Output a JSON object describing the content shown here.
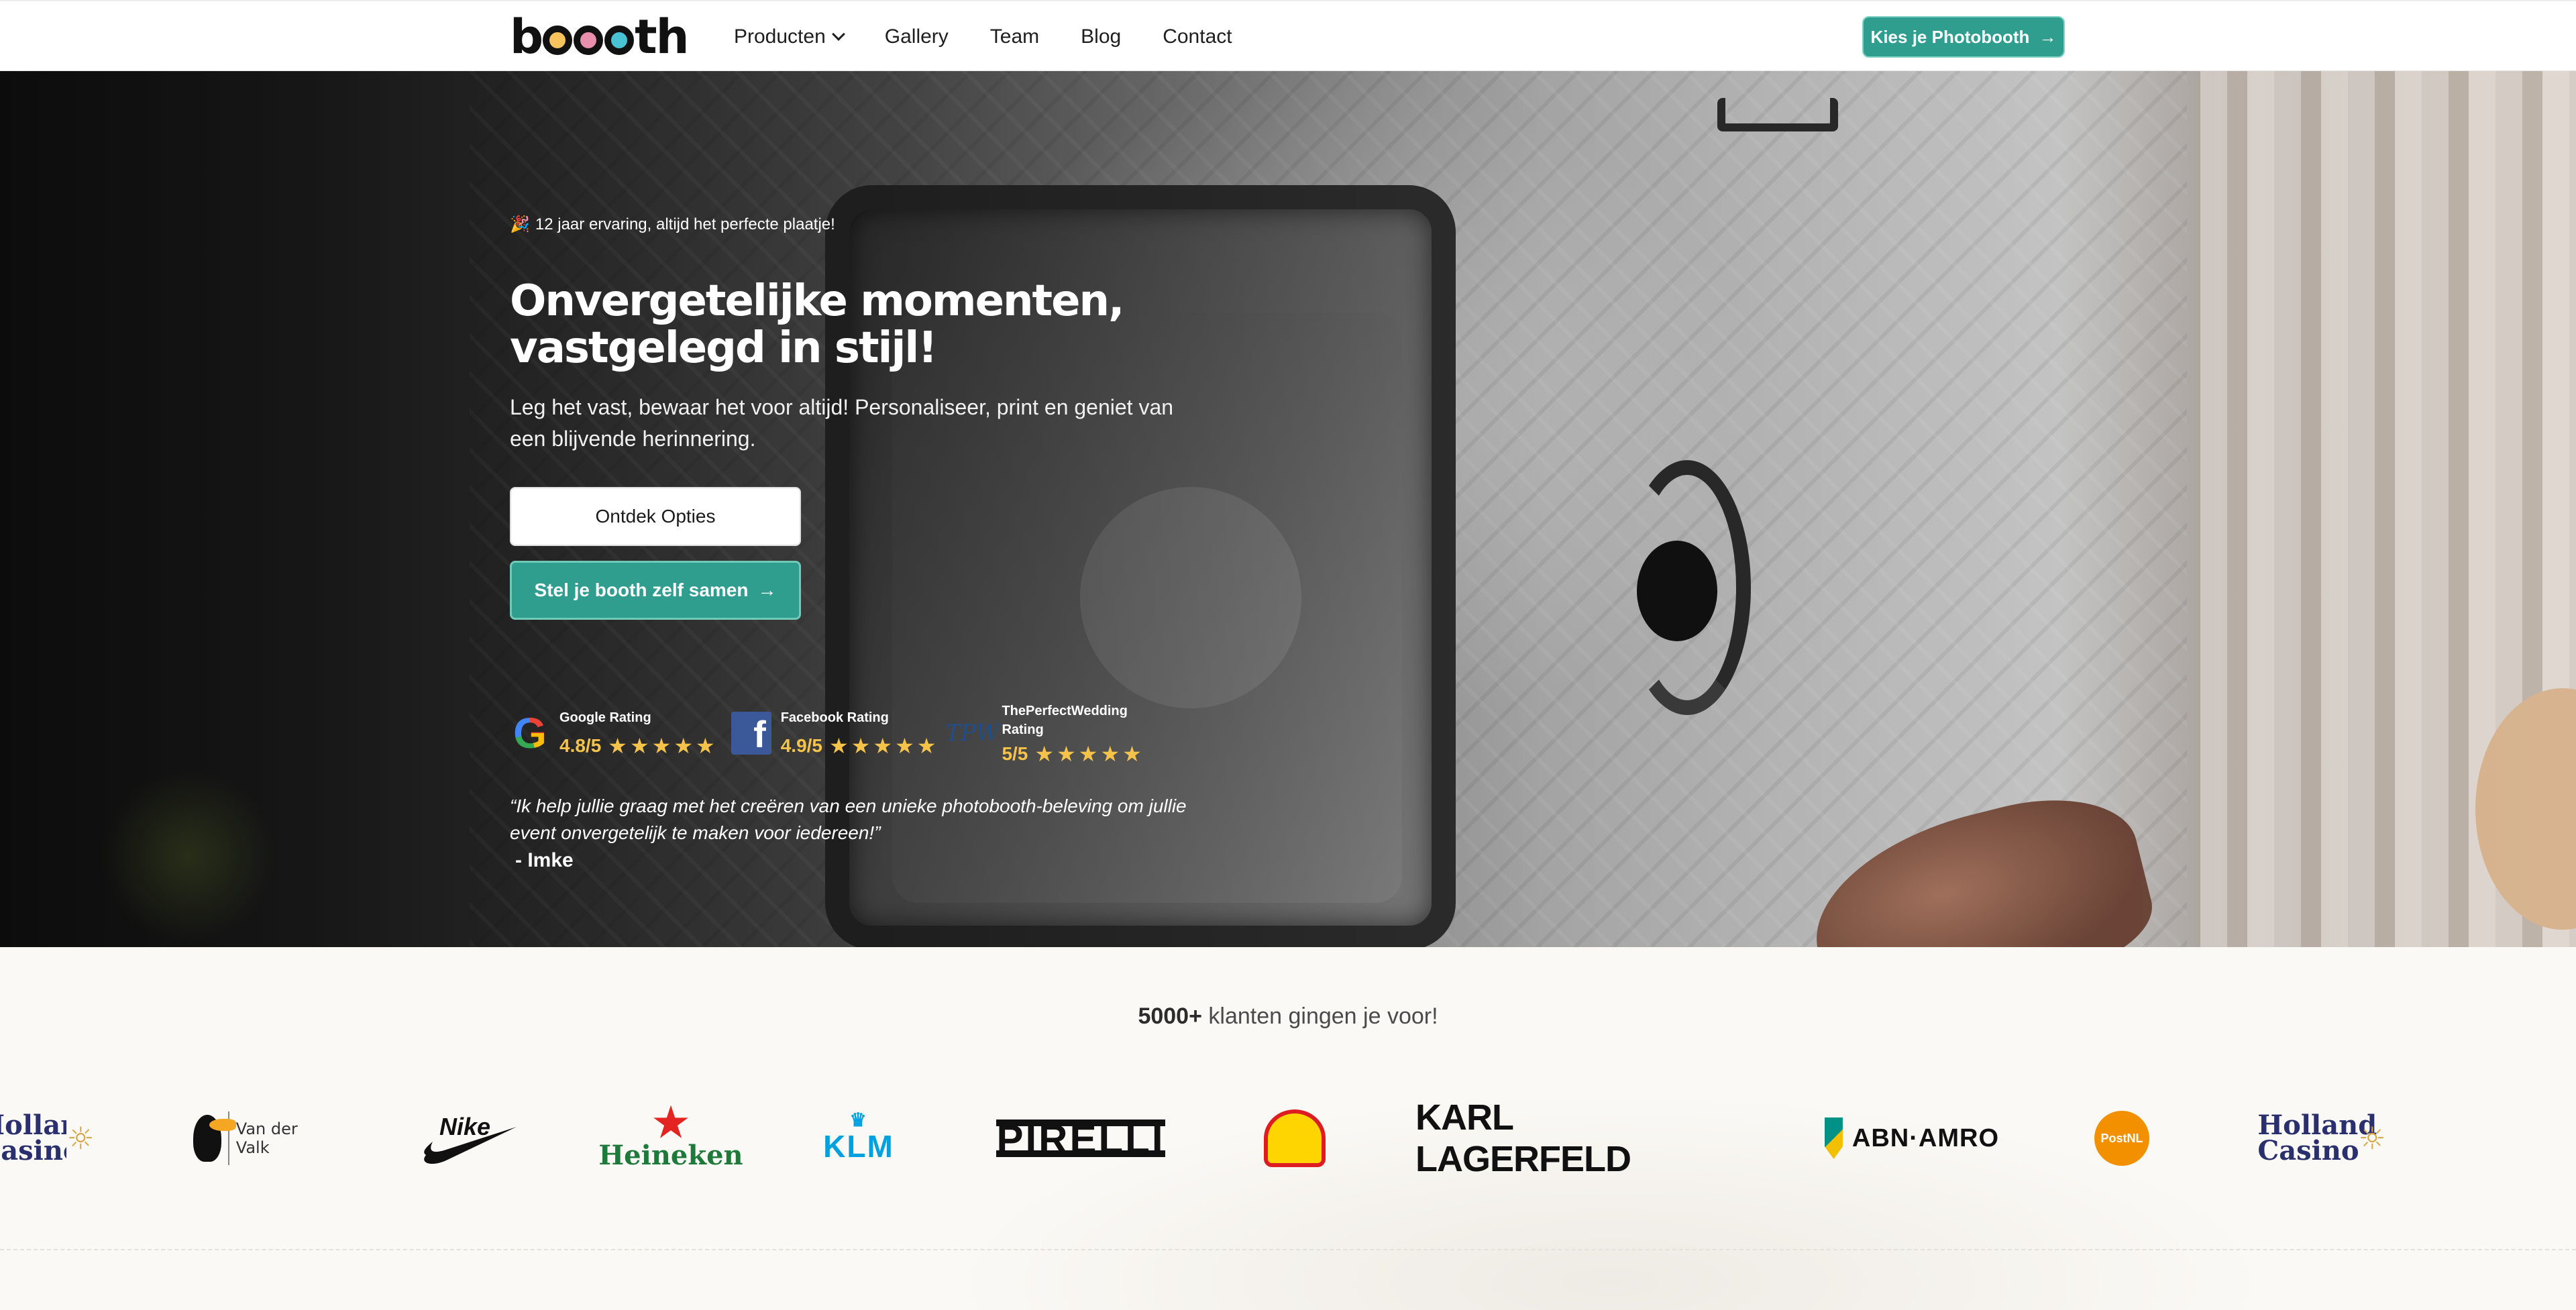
{
  "nav": {
    "logo_text": "booth",
    "items": [
      {
        "label": "Producten",
        "has_dropdown": true
      },
      {
        "label": "Gallery"
      },
      {
        "label": "Team"
      },
      {
        "label": "Blog"
      },
      {
        "label": "Contact"
      }
    ],
    "cta_label": "Kies je Photobooth",
    "cta_icon": "arrow-right-icon"
  },
  "hero": {
    "eyebrow": "12 jaar ervaring, altijd het perfecte plaatje!",
    "eyebrow_icon": "party-popper-icon",
    "headline_line1": "Onvergetelijke momenten,",
    "headline_line2": "vastgelegd in stijl!",
    "subtext": "Leg het vast, bewaar het voor altijd! Personaliseer, print en geniet van een blijvende herinnering.",
    "primary_button": "Ontdek Opties",
    "secondary_button": "Stel je booth zelf samen",
    "ratings": [
      {
        "label": "Google Rating",
        "score": "4.8/5",
        "icon": "google-icon",
        "stars": 5
      },
      {
        "label": "Facebook Rating",
        "score": "4.9/5",
        "icon": "facebook-icon",
        "stars": 5
      },
      {
        "label": "ThePerfectWedding Rating",
        "score": "5/5",
        "icon": "theperfectwedding-icon",
        "stars": 5
      }
    ],
    "quote": "“Ik help jullie graag met het creëren van een unieke photobooth-beleving om jullie event onvergetelijk te maken voor iedereen!”",
    "quote_author": "- Imke"
  },
  "clients": {
    "title_bold": "5000+",
    "title_rest": " klanten gingen je voor!",
    "logos": [
      "Holland Casino",
      "Van der Valk",
      "Nike",
      "Heineken",
      "KLM",
      "Pirelli",
      "Shell",
      "Karl Lagerfeld",
      "ABN·AMRO",
      "PostNL",
      "Holland Casino"
    ]
  },
  "colors": {
    "accent": "#2f9e8f",
    "star": "#f5c34a",
    "nav_bg": "#ffffff",
    "section_bg": "#fbf9f5"
  }
}
